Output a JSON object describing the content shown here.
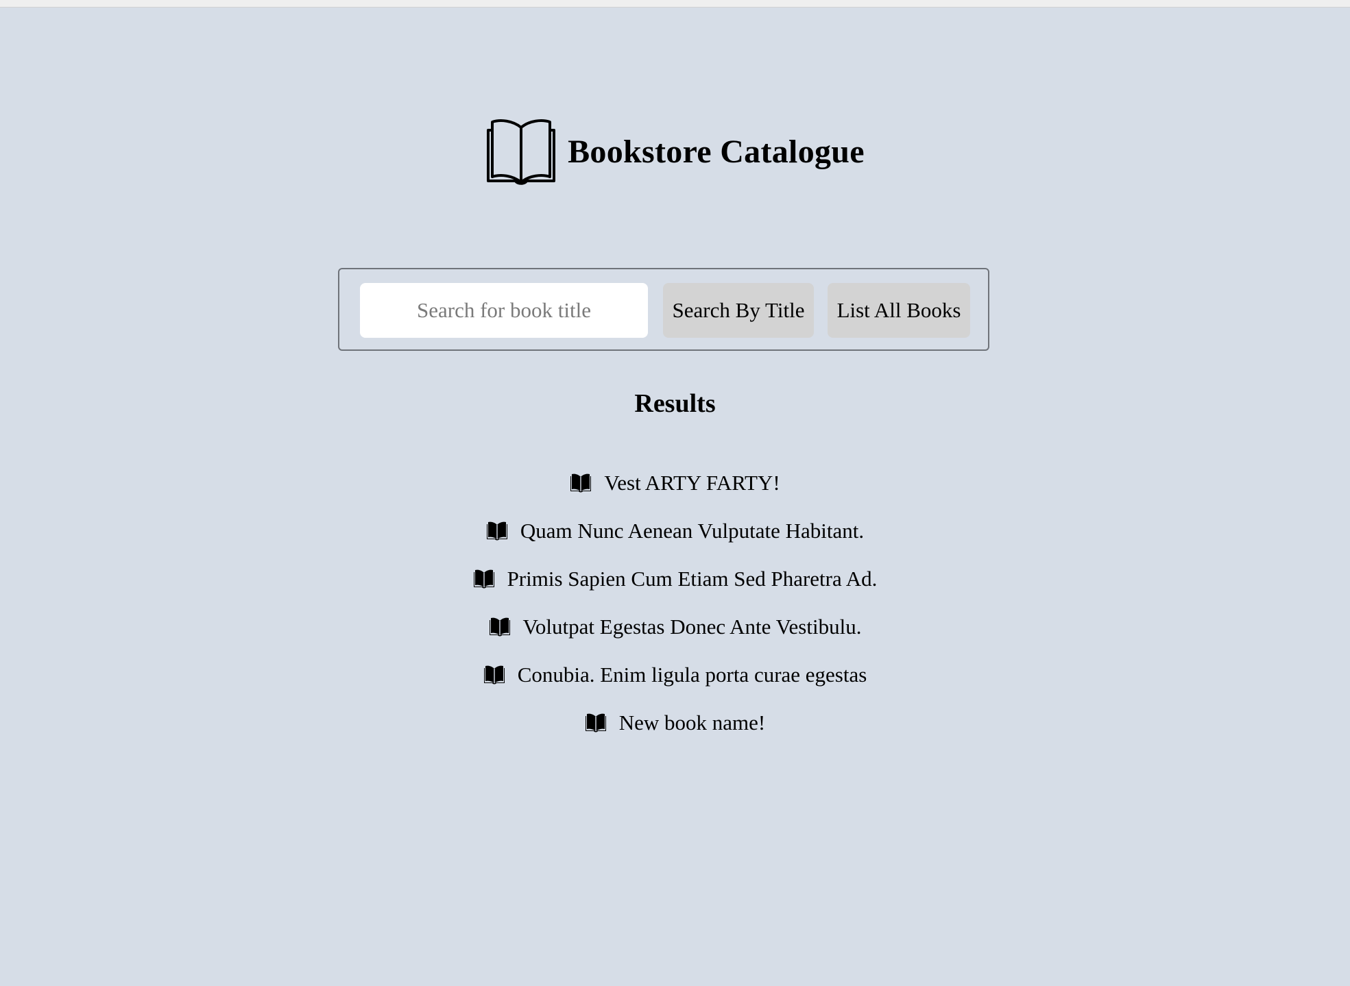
{
  "header": {
    "logo_icon": "open-book-outline-icon",
    "title": "Bookstore Catalogue"
  },
  "search": {
    "placeholder": "Search for book title",
    "value": "",
    "search_button_label": "Search By Title",
    "list_button_label": "List All Books"
  },
  "results": {
    "heading": "Results",
    "item_icon": "open-book-filled-icon",
    "items": [
      {
        "title": "Vest ARTY FARTY!"
      },
      {
        "title": "Quam Nunc Aenean Vulputate Habitant."
      },
      {
        "title": "Primis Sapien Cum Etiam Sed Pharetra Ad."
      },
      {
        "title": "Volutpat Egestas Donec Ante Vestibulu."
      },
      {
        "title": "Conubia. Enim ligula porta curae egestas"
      },
      {
        "title": "New book name!"
      }
    ]
  },
  "colors": {
    "background": "#d6dde7",
    "button": "#d3d3d3",
    "panel_border": "#6f737a"
  }
}
